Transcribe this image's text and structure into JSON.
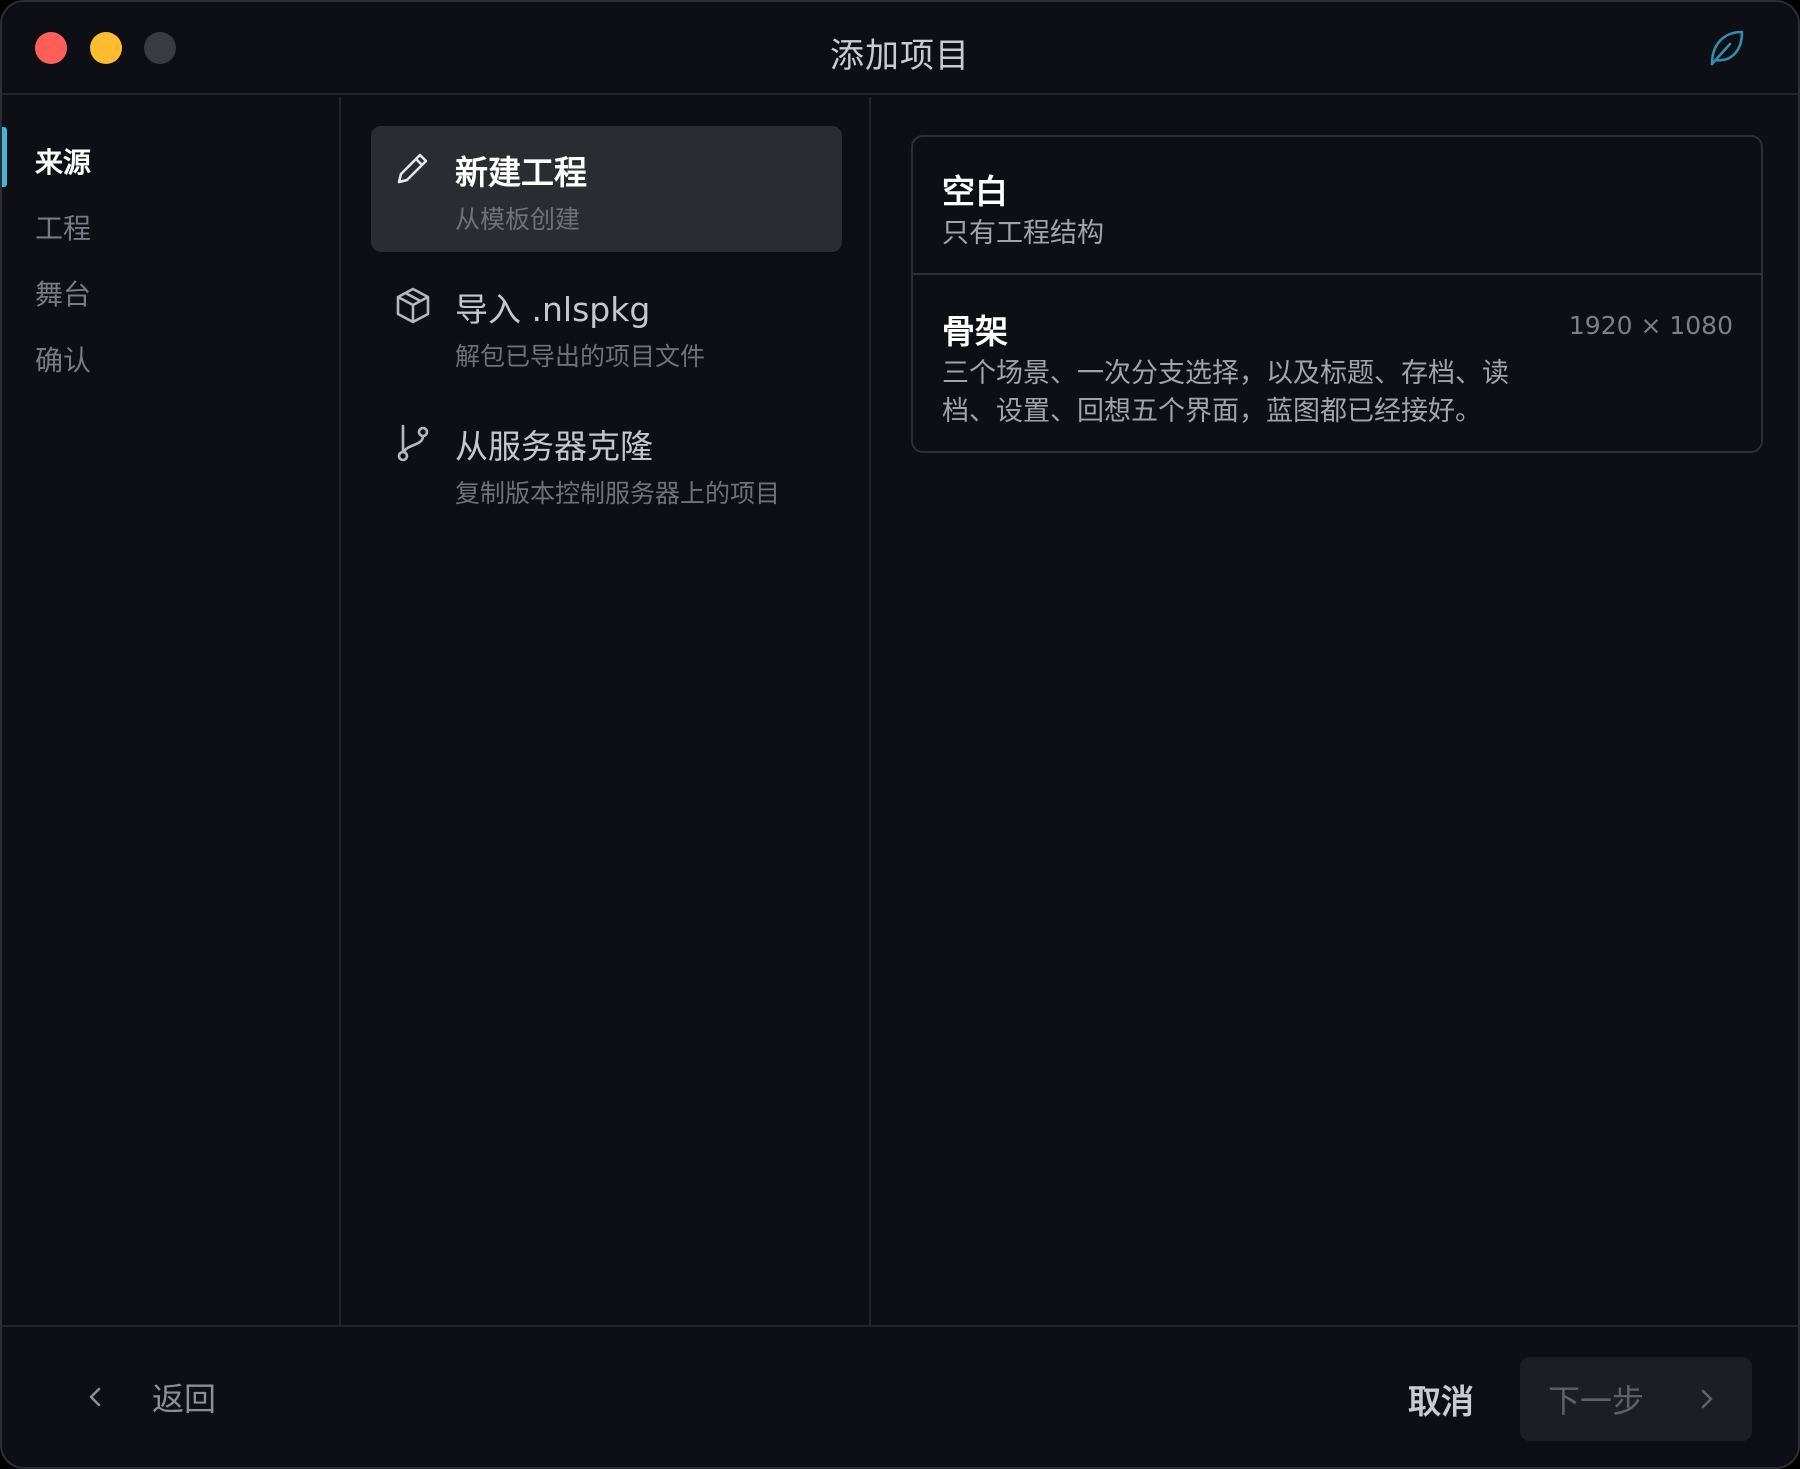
{
  "window": {
    "title": "添加项目"
  },
  "sidebar": {
    "steps": [
      {
        "label": "来源",
        "active": true
      },
      {
        "label": "工程",
        "active": false
      },
      {
        "label": "舞台",
        "active": false
      },
      {
        "label": "确认",
        "active": false
      }
    ]
  },
  "sources": {
    "items": [
      {
        "title": "新建工程",
        "subtitle": "从模板创建",
        "icon": "pencil-icon",
        "selected": true
      },
      {
        "title": "导入 .nlspkg",
        "subtitle": "解包已导出的项目文件",
        "icon": "package-icon",
        "selected": false
      },
      {
        "title": "从服务器克隆",
        "subtitle": "复制版本控制服务器上的项目",
        "icon": "git-branch-icon",
        "selected": false
      }
    ]
  },
  "templates": {
    "items": [
      {
        "name": "空白",
        "description": "只有工程结构"
      },
      {
        "name": "骨架",
        "description": "三个场景、一次分支选择，以及标题、存档、读档、设置、回想五个界面，蓝图都已经接好。",
        "size": "1920 × 1080"
      }
    ]
  },
  "footer": {
    "back_label": "返回",
    "cancel_label": "取消",
    "next_label": "下一步"
  },
  "colors": {
    "accent": "#4ab3d8",
    "close": "#fe5f57",
    "minimize": "#febc2e",
    "zoom_disabled": "#3a3c42",
    "background": "#0d0f14"
  }
}
